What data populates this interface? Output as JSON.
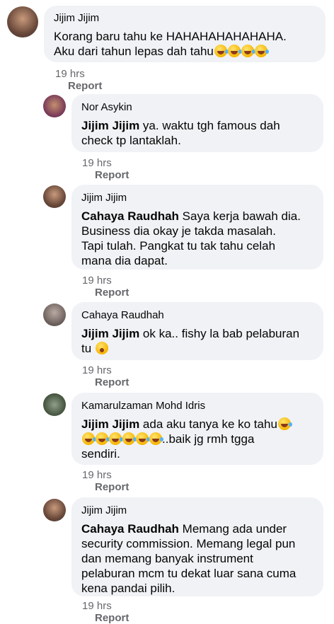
{
  "report_label": "Report",
  "comments": [
    {
      "author": "Jijim Jijim",
      "text_1": "Korang baru tahu ke HAHAHAHAHAHAHA.",
      "text_2": "Aku dari tahun lepas dah tahu",
      "time": "19 hrs"
    },
    {
      "author": "Nor Asykin",
      "mention": "Jijim Jijim",
      "text_1": " ya. waktu tgh famous dah",
      "text_2": "check tp lantaklah.",
      "time": "19 hrs"
    },
    {
      "author": "Jijim Jijim",
      "mention": "Cahaya Raudhah",
      "text_1": " Saya kerja bawah dia.",
      "text_2": "Business dia okay je takda masalah.",
      "text_3": "Tapi tulah. Pangkat tu tak tahu celah",
      "text_4": "mana dia dapat.",
      "time": "19 hrs"
    },
    {
      "author": "Cahaya Raudhah",
      "mention": "Jijim Jijim",
      "text_1": " ok ka.. fishy la bab pelaburan",
      "text_2": "tu",
      "time": "19 hrs"
    },
    {
      "author": "Kamarulzaman Mohd Idris",
      "mention": "Jijim Jijim",
      "text_1": " ada aku tanya ke ko tahu",
      "text_2": "..baik jg rmh tgga",
      "text_3": "sendiri.",
      "time": "19 hrs"
    },
    {
      "author": "Jijim Jijim",
      "mention": "Cahaya Raudhah",
      "text_1": " Memang ada under",
      "text_2": "security commission. Memang legal pun",
      "text_3": "dan memang banyak instrument",
      "text_4": "pelaburan mcm tu dekat luar sana cuma",
      "text_5": "kena pandai pilih.",
      "time": "19 hrs"
    }
  ]
}
